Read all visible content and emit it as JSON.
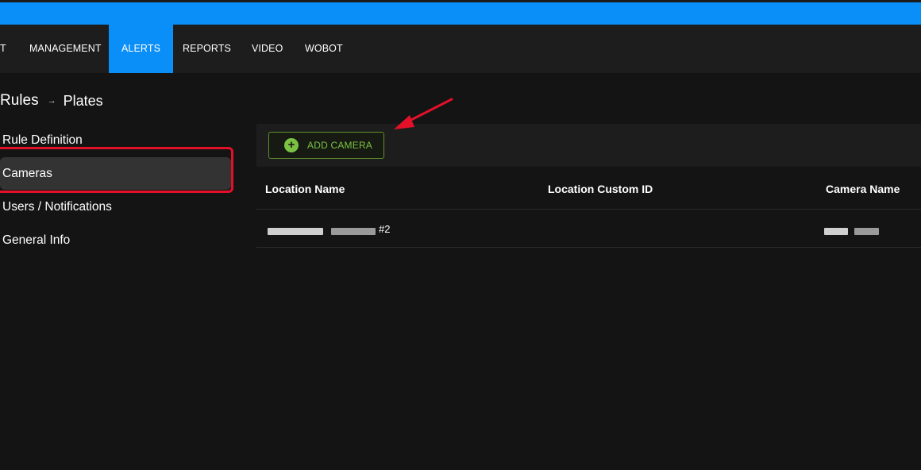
{
  "nav": {
    "partial": "T",
    "items": [
      {
        "label": "MANAGEMENT"
      },
      {
        "label": "ALERTS",
        "active": true
      },
      {
        "label": "REPORTS"
      },
      {
        "label": "VIDEO"
      },
      {
        "label": "WOBOT"
      }
    ]
  },
  "breadcrumb": {
    "root": "Rules",
    "separator": "→",
    "current": "Plates"
  },
  "sidebar": {
    "items": [
      {
        "label": "Rule Definition"
      },
      {
        "label": "Cameras",
        "active": true
      },
      {
        "label": "Users / Notifications"
      },
      {
        "label": "General Info"
      }
    ]
  },
  "toolbar": {
    "add_camera_label": "ADD CAMERA"
  },
  "table": {
    "headers": [
      "Location Name",
      "Location Custom ID",
      "Camera Name"
    ],
    "rows": [
      {
        "location_suffix": "#2",
        "custom_id": ""
      }
    ]
  },
  "colors": {
    "accent": "#0a8ef7",
    "add_green": "#7bc142",
    "annotation_red": "#e3102a"
  },
  "icons": [
    "plus-circle-icon",
    "arrow-right-icon"
  ]
}
